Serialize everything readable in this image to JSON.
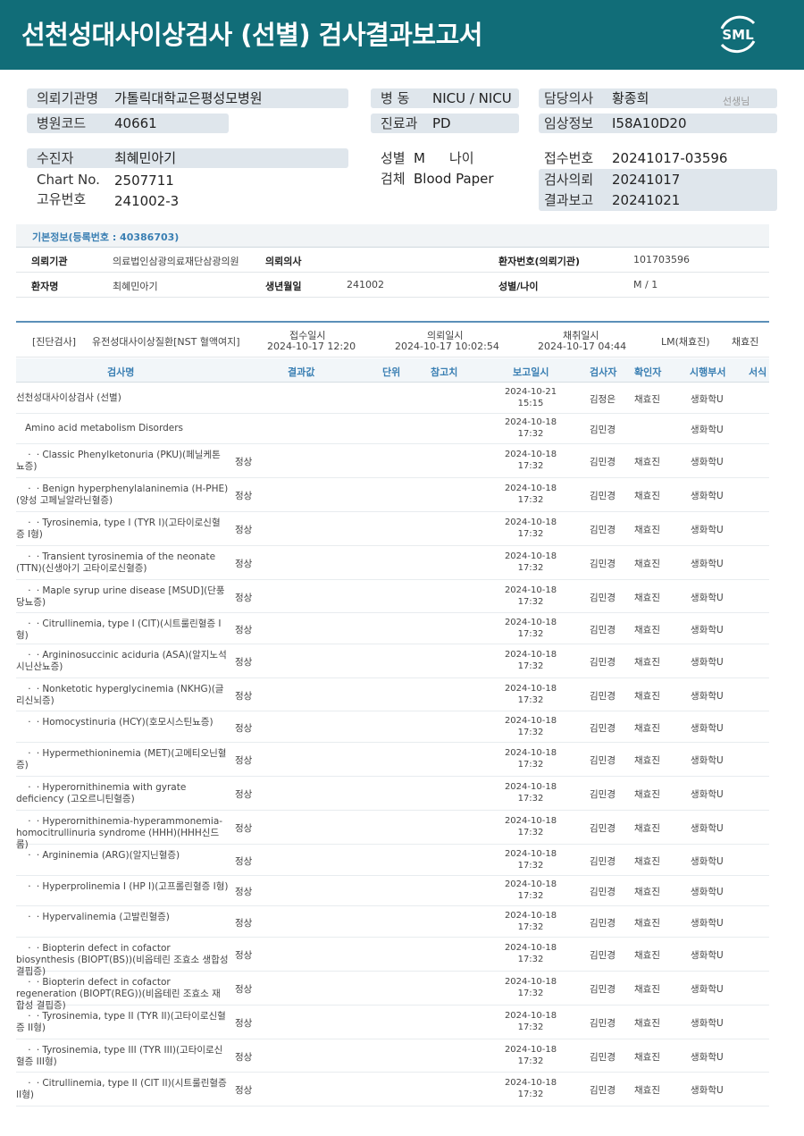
{
  "title": "선천성대사이상검사 (선별) 검사결과보고서",
  "logo_text": "SML",
  "colors": {
    "header": "#116d78",
    "accent": "#3a7fb3",
    "pill": "#dfe6ec"
  },
  "hospital": {
    "label": "의뢰기관명",
    "value": "가톨릭대학교은평성모병원",
    "code_label": "병원코드",
    "code": "40661"
  },
  "ward": {
    "label": "병 동",
    "value": "NICU / NICU",
    "dept_label": "진료과",
    "dept": "PD"
  },
  "doctor": {
    "label": "담당의사",
    "value": "황종희",
    "suffix": "선생님",
    "clinical_label": "임상정보",
    "clinical": "I58A10D20"
  },
  "patient": {
    "label": "수진자",
    "name": "최혜민아기",
    "chart_label": "Chart No.",
    "chart": "2507711",
    "uid_label": "고유번호",
    "uid": "241002-3",
    "sex_label": "성별",
    "sex": "M",
    "age_label": "나이",
    "specimen_label": "검체",
    "specimen": "Blood Paper"
  },
  "receipt": {
    "no_label": "접수번호",
    "no": "20241017-03596",
    "req_label": "검사의뢰",
    "req": "20241017",
    "report_label": "결과보고",
    "report": "20241021"
  },
  "basic_info": {
    "title": "기본정보(등록번호 : 40386703)",
    "inst_label": "의뢰기관",
    "inst": "의료법인삼광의료재단삼광의원",
    "doc_label": "의뢰의사",
    "doc": "",
    "pid_label": "환자번호(의뢰기관)",
    "pid": "101703596",
    "name_label": "환자명",
    "name": "최혜민아기",
    "dob_label": "생년월일",
    "dob": "241002",
    "sexage_label": "성별/나이",
    "sexage": "M / 1"
  },
  "diagnosis": {
    "tag": "[진단검사]",
    "test": "유전성대사이상질환[NST 혈액여지]",
    "recv_label": "접수일시",
    "recv": "2024-10-17 12:20",
    "req_label": "의뢰일시",
    "req": "2024-10-17 10:02:54",
    "coll_label": "채취일시",
    "coll": "2024-10-17 04:44",
    "lm": "LM(채효진)",
    "signer": "채효진"
  },
  "table_headers": {
    "name": "검사명",
    "result": "결과값",
    "unit": "단위",
    "ref": "참고치",
    "date": "보고일시",
    "tech": "검사자",
    "confirm": "확인자",
    "dept": "시행부서",
    "form": "서식"
  },
  "rows": [
    {
      "name": "선천성대사이상검사 (선별)",
      "indent": false,
      "result": "",
      "date1": "2024-10-21",
      "date2": "15:15",
      "tech": "김정은",
      "confirm": "채효진",
      "dept": "생화학U",
      "h": 35
    },
    {
      "name": "Amino acid metabolism Disorders",
      "indent": true,
      "result": "",
      "date1": "2024-10-18",
      "date2": "17:32",
      "tech": "김민경",
      "confirm": "",
      "dept": "생화학U",
      "h": 34
    },
    {
      "name": "ㆍㆍClassic Phenylketonuria (PKU)(페닐케톤뇨증)",
      "indent": true,
      "result": "정상",
      "date1": "2024-10-18",
      "date2": "17:32",
      "tech": "김민경",
      "confirm": "채효진",
      "dept": "생화학U",
      "h": 38
    },
    {
      "name": "ㆍㆍBenign hyperphenylalaninemia (H-PHE)(양성 고페닐알라닌혈증)",
      "indent": true,
      "result": "정상",
      "date1": "2024-10-18",
      "date2": "17:32",
      "tech": "김민경",
      "confirm": "채효진",
      "dept": "생화학U",
      "h": 38
    },
    {
      "name": "ㆍㆍTyrosinemia, type I (TYR I)(고타이로신혈증 I형)",
      "indent": true,
      "result": "정상",
      "date1": "2024-10-18",
      "date2": "17:32",
      "tech": "김민경",
      "confirm": "채효진",
      "dept": "생화학U",
      "h": 38
    },
    {
      "name": "ㆍㆍTransient tyrosinemia of the neonate (TTN)(신생아기 고타이로신혈증)",
      "indent": true,
      "result": "정상",
      "date1": "2024-10-18",
      "date2": "17:32",
      "tech": "김민경",
      "confirm": "채효진",
      "dept": "생화학U",
      "h": 38
    },
    {
      "name": "ㆍㆍMaple syrup urine disease [MSUD](단풍당뇨증)",
      "indent": true,
      "result": "정상",
      "date1": "2024-10-18",
      "date2": "17:32",
      "tech": "김민경",
      "confirm": "채효진",
      "dept": "생화학U",
      "h": 37
    },
    {
      "name": "ㆍㆍCitrullinemia, type I (CIT)(시트룰린혈증 I형)",
      "indent": true,
      "result": "정상",
      "date1": "2024-10-18",
      "date2": "17:32",
      "tech": "김민경",
      "confirm": "채효진",
      "dept": "생화학U",
      "h": 35
    },
    {
      "name": "ㆍㆍArgininosuccinic aciduria (ASA)(알지노석시닌산뇨증)",
      "indent": true,
      "result": "정상",
      "date1": "2024-10-18",
      "date2": "17:32",
      "tech": "김민경",
      "confirm": "채효진",
      "dept": "생화학U",
      "h": 38
    },
    {
      "name": "ㆍㆍNonketotic hyperglycinemia (NKHG)(글리신뇌증)",
      "indent": true,
      "result": "정상",
      "date1": "2024-10-18",
      "date2": "17:32",
      "tech": "김민경",
      "confirm": "채효진",
      "dept": "생화학U",
      "h": 37
    },
    {
      "name": "ㆍㆍHomocystinuria (HCY)(호모시스틴뇨증)",
      "indent": true,
      "result": "정상",
      "date1": "2024-10-18",
      "date2": "17:32",
      "tech": "김민경",
      "confirm": "채효진",
      "dept": "생화학U",
      "h": 35
    },
    {
      "name": "ㆍㆍHypermethioninemia (MET)(고메티오닌혈증)",
      "indent": true,
      "result": "정상",
      "date1": "2024-10-18",
      "date2": "17:32",
      "tech": "김민경",
      "confirm": "채효진",
      "dept": "생화학U",
      "h": 38
    },
    {
      "name": "ㆍㆍHyperornithinemia with gyrate deficiency (고오르니틴혈증)",
      "indent": true,
      "result": "정상",
      "date1": "2024-10-18",
      "date2": "17:32",
      "tech": "김민경",
      "confirm": "채효진",
      "dept": "생화학U",
      "h": 38
    },
    {
      "name": "ㆍㆍHyperornithinemia-hyperammonemia-homocitrullinuria syndrome (HHH)(HHH신드롬)",
      "indent": true,
      "result": "정상",
      "date1": "2024-10-18",
      "date2": "17:32",
      "tech": "김민경",
      "confirm": "채효진",
      "dept": "생화학U",
      "h": 38
    },
    {
      "name": "ㆍㆍArgininemia (ARG)(알지닌혈증)",
      "indent": true,
      "result": "정상",
      "date1": "2024-10-18",
      "date2": "17:32",
      "tech": "김민경",
      "confirm": "채효진",
      "dept": "생화학U",
      "h": 35
    },
    {
      "name": "ㆍㆍHyperprolinemia I (HP I)(고프롤린혈증 I형)",
      "indent": true,
      "result": "정상",
      "date1": "2024-10-18",
      "date2": "17:32",
      "tech": "김민경",
      "confirm": "채효진",
      "dept": "생화학U",
      "h": 34
    },
    {
      "name": "ㆍㆍHypervalinemia (고발린혈증)",
      "indent": true,
      "result": "정상",
      "date1": "2024-10-18",
      "date2": "17:32",
      "tech": "김민경",
      "confirm": "채효진",
      "dept": "생화학U",
      "h": 35
    },
    {
      "name": "ㆍㆍBiopterin defect in cofactor biosynthesis (BIOPT(BS))(비옵테린 조효소 생합성 결핍증)",
      "indent": true,
      "result": "정상",
      "date1": "2024-10-18",
      "date2": "17:32",
      "tech": "김민경",
      "confirm": "채효진",
      "dept": "생화학U",
      "h": 38
    },
    {
      "name": "ㆍㆍBiopterin defect in cofactor regeneration (BIOPT(REG))(비옵테린 조효소 재합성 결핍증)",
      "indent": true,
      "result": "정상",
      "date1": "2024-10-18",
      "date2": "17:32",
      "tech": "김민경",
      "confirm": "채효진",
      "dept": "생화학U",
      "h": 38
    },
    {
      "name": "ㆍㆍTyrosinemia, type II (TYR II)(고타이로신혈증 II형)",
      "indent": true,
      "result": "정상",
      "date1": "2024-10-18",
      "date2": "17:32",
      "tech": "김민경",
      "confirm": "채효진",
      "dept": "생화학U",
      "h": 38
    },
    {
      "name": "ㆍㆍTyrosinemia, type III (TYR III)(고타이로신혈증 III형)",
      "indent": true,
      "result": "정상",
      "date1": "2024-10-18",
      "date2": "17:32",
      "tech": "김민경",
      "confirm": "채효진",
      "dept": "생화학U",
      "h": 37
    },
    {
      "name": "ㆍㆍCitrullinemia, type II (CIT II)(시트룰린혈증 II형)",
      "indent": true,
      "result": "정상",
      "date1": "2024-10-18",
      "date2": "17:32",
      "tech": "김민경",
      "confirm": "채효진",
      "dept": "생화학U",
      "h": 38
    }
  ]
}
